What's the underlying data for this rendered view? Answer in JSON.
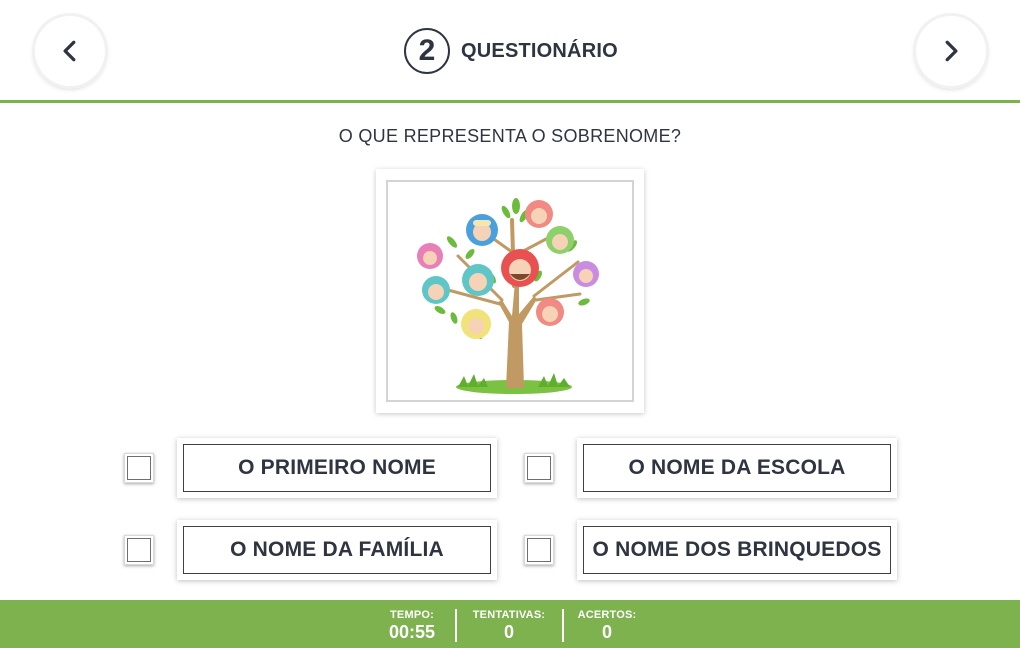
{
  "header": {
    "step_number": "2",
    "title": "QUESTIONÁRIO",
    "prev_icon": "chevron-left-icon",
    "next_icon": "chevron-right-icon"
  },
  "question": {
    "text": "O QUE REPRESENTA O SOBRENOME?",
    "image_icon": "family-tree-illustration"
  },
  "options": [
    {
      "label": "O PRIMEIRO NOME"
    },
    {
      "label": "O NOME DA ESCOLA"
    },
    {
      "label": "O NOME DA FAMÍLIA"
    },
    {
      "label": "O NOME DOS BRINQUEDOS"
    }
  ],
  "footer": {
    "time_label": "TEMPO:",
    "time_value": "00:55",
    "attempts_label": "TENTATIVAS:",
    "attempts_value": "0",
    "hits_label": "ACERTOS:",
    "hits_value": "0"
  },
  "colors": {
    "accent_green": "#7db24f",
    "text_dark": "#2f3540"
  }
}
